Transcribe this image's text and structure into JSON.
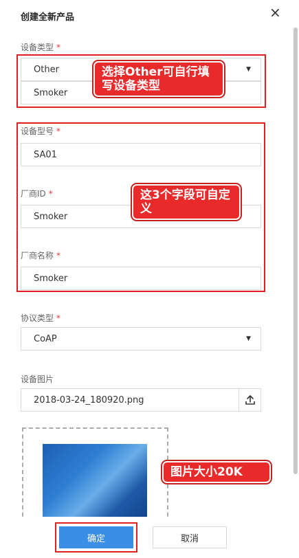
{
  "dialog": {
    "title": "创建全新产品",
    "close_glyph": "×"
  },
  "device_type": {
    "label": "设备类型",
    "required_mark": "*",
    "selected": "Other",
    "custom_value": "Smoker"
  },
  "callouts": {
    "type_hint": "选择Other可自行填写设备类型",
    "fields_hint": "这3个字段可自定义",
    "image_hint": "图片大小20K"
  },
  "device_model": {
    "label": "设备型号",
    "required_mark": "*",
    "value": "SA01"
  },
  "vendor_id": {
    "label": "厂商ID",
    "required_mark": "*",
    "value": "Smoker"
  },
  "vendor_name": {
    "label": "厂商名称",
    "required_mark": "*",
    "value": "Smoker"
  },
  "protocol": {
    "label": "协议类型",
    "required_mark": "*",
    "selected": "CoAP"
  },
  "device_image": {
    "label": "设备图片",
    "filename": "2018-03-24_180920.png"
  },
  "footer": {
    "confirm_label": "确定",
    "cancel_label": "取消"
  },
  "colors": {
    "annotation_red": "#e02020",
    "primary_blue": "#3a8ee6",
    "required_red": "#e4393c"
  }
}
